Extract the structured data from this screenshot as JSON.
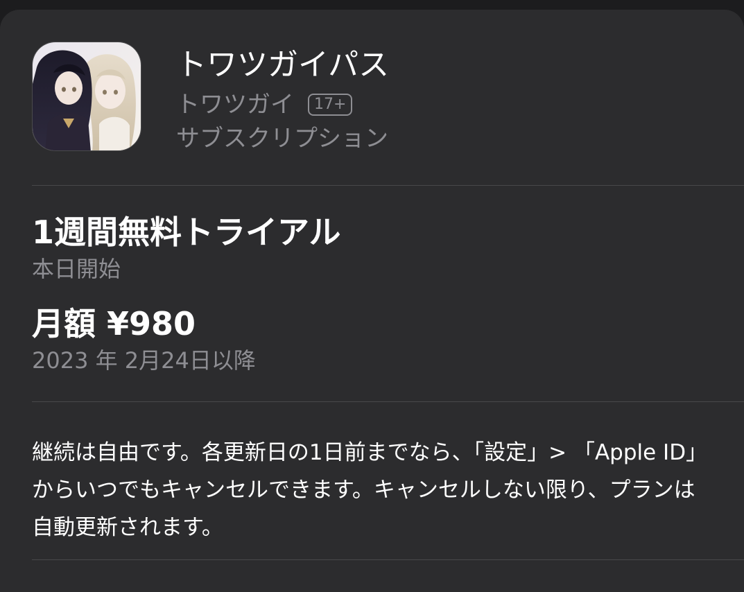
{
  "app": {
    "name": "トワツガイパス",
    "developer": "トワツガイ",
    "age_rating": "17+",
    "type": "サブスクリプション",
    "icon": "app-icon-anime-characters"
  },
  "offer": {
    "title": "1週間無料トライアル",
    "subtitle": "本日開始"
  },
  "price": {
    "title": "月額 ¥980",
    "subtitle": "2023 年 2月24日以降"
  },
  "note": {
    "text": "継続は自由です。各更新日の1日前までなら、「設定」> 「Apple ID」からいつでもキャンセルできます。キャンセルしない限り、プランは自動更新されます。"
  },
  "colors": {
    "background": "#2c2c2e",
    "primary_text": "#ffffff",
    "secondary_text": "#8e8e93",
    "divider": "#48484a"
  }
}
